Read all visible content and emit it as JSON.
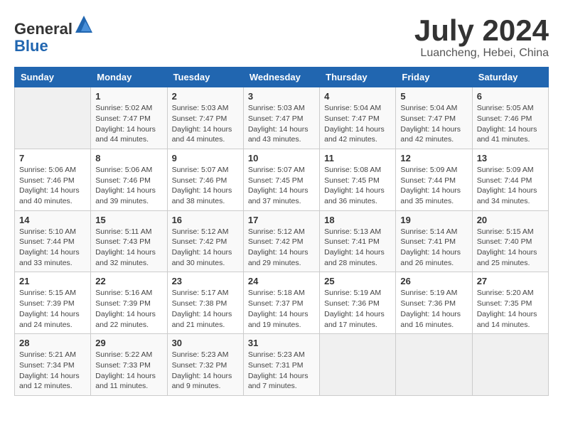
{
  "header": {
    "logo_general": "General",
    "logo_blue": "Blue",
    "month_title": "July 2024",
    "location": "Luancheng, Hebei, China"
  },
  "days_of_week": [
    "Sunday",
    "Monday",
    "Tuesday",
    "Wednesday",
    "Thursday",
    "Friday",
    "Saturday"
  ],
  "weeks": [
    [
      {
        "day": "",
        "info": ""
      },
      {
        "day": "1",
        "info": "Sunrise: 5:02 AM\nSunset: 7:47 PM\nDaylight: 14 hours\nand 44 minutes."
      },
      {
        "day": "2",
        "info": "Sunrise: 5:03 AM\nSunset: 7:47 PM\nDaylight: 14 hours\nand 44 minutes."
      },
      {
        "day": "3",
        "info": "Sunrise: 5:03 AM\nSunset: 7:47 PM\nDaylight: 14 hours\nand 43 minutes."
      },
      {
        "day": "4",
        "info": "Sunrise: 5:04 AM\nSunset: 7:47 PM\nDaylight: 14 hours\nand 42 minutes."
      },
      {
        "day": "5",
        "info": "Sunrise: 5:04 AM\nSunset: 7:47 PM\nDaylight: 14 hours\nand 42 minutes."
      },
      {
        "day": "6",
        "info": "Sunrise: 5:05 AM\nSunset: 7:46 PM\nDaylight: 14 hours\nand 41 minutes."
      }
    ],
    [
      {
        "day": "7",
        "info": "Sunrise: 5:06 AM\nSunset: 7:46 PM\nDaylight: 14 hours\nand 40 minutes."
      },
      {
        "day": "8",
        "info": "Sunrise: 5:06 AM\nSunset: 7:46 PM\nDaylight: 14 hours\nand 39 minutes."
      },
      {
        "day": "9",
        "info": "Sunrise: 5:07 AM\nSunset: 7:46 PM\nDaylight: 14 hours\nand 38 minutes."
      },
      {
        "day": "10",
        "info": "Sunrise: 5:07 AM\nSunset: 7:45 PM\nDaylight: 14 hours\nand 37 minutes."
      },
      {
        "day": "11",
        "info": "Sunrise: 5:08 AM\nSunset: 7:45 PM\nDaylight: 14 hours\nand 36 minutes."
      },
      {
        "day": "12",
        "info": "Sunrise: 5:09 AM\nSunset: 7:44 PM\nDaylight: 14 hours\nand 35 minutes."
      },
      {
        "day": "13",
        "info": "Sunrise: 5:09 AM\nSunset: 7:44 PM\nDaylight: 14 hours\nand 34 minutes."
      }
    ],
    [
      {
        "day": "14",
        "info": "Sunrise: 5:10 AM\nSunset: 7:44 PM\nDaylight: 14 hours\nand 33 minutes."
      },
      {
        "day": "15",
        "info": "Sunrise: 5:11 AM\nSunset: 7:43 PM\nDaylight: 14 hours\nand 32 minutes."
      },
      {
        "day": "16",
        "info": "Sunrise: 5:12 AM\nSunset: 7:42 PM\nDaylight: 14 hours\nand 30 minutes."
      },
      {
        "day": "17",
        "info": "Sunrise: 5:12 AM\nSunset: 7:42 PM\nDaylight: 14 hours\nand 29 minutes."
      },
      {
        "day": "18",
        "info": "Sunrise: 5:13 AM\nSunset: 7:41 PM\nDaylight: 14 hours\nand 28 minutes."
      },
      {
        "day": "19",
        "info": "Sunrise: 5:14 AM\nSunset: 7:41 PM\nDaylight: 14 hours\nand 26 minutes."
      },
      {
        "day": "20",
        "info": "Sunrise: 5:15 AM\nSunset: 7:40 PM\nDaylight: 14 hours\nand 25 minutes."
      }
    ],
    [
      {
        "day": "21",
        "info": "Sunrise: 5:15 AM\nSunset: 7:39 PM\nDaylight: 14 hours\nand 24 minutes."
      },
      {
        "day": "22",
        "info": "Sunrise: 5:16 AM\nSunset: 7:39 PM\nDaylight: 14 hours\nand 22 minutes."
      },
      {
        "day": "23",
        "info": "Sunrise: 5:17 AM\nSunset: 7:38 PM\nDaylight: 14 hours\nand 21 minutes."
      },
      {
        "day": "24",
        "info": "Sunrise: 5:18 AM\nSunset: 7:37 PM\nDaylight: 14 hours\nand 19 minutes."
      },
      {
        "day": "25",
        "info": "Sunrise: 5:19 AM\nSunset: 7:36 PM\nDaylight: 14 hours\nand 17 minutes."
      },
      {
        "day": "26",
        "info": "Sunrise: 5:19 AM\nSunset: 7:36 PM\nDaylight: 14 hours\nand 16 minutes."
      },
      {
        "day": "27",
        "info": "Sunrise: 5:20 AM\nSunset: 7:35 PM\nDaylight: 14 hours\nand 14 minutes."
      }
    ],
    [
      {
        "day": "28",
        "info": "Sunrise: 5:21 AM\nSunset: 7:34 PM\nDaylight: 14 hours\nand 12 minutes."
      },
      {
        "day": "29",
        "info": "Sunrise: 5:22 AM\nSunset: 7:33 PM\nDaylight: 14 hours\nand 11 minutes."
      },
      {
        "day": "30",
        "info": "Sunrise: 5:23 AM\nSunset: 7:32 PM\nDaylight: 14 hours\nand 9 minutes."
      },
      {
        "day": "31",
        "info": "Sunrise: 5:23 AM\nSunset: 7:31 PM\nDaylight: 14 hours\nand 7 minutes."
      },
      {
        "day": "",
        "info": ""
      },
      {
        "day": "",
        "info": ""
      },
      {
        "day": "",
        "info": ""
      }
    ]
  ]
}
